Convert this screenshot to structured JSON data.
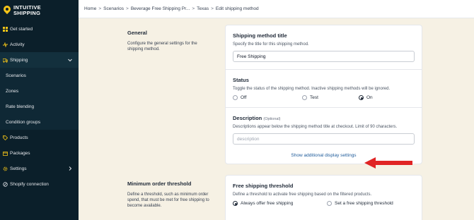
{
  "brand": {
    "line1": "INTUITIVE",
    "line2": "SHIPPING"
  },
  "sidebar": {
    "items": [
      {
        "label": "Get started",
        "icon": "grid-icon"
      },
      {
        "label": "Activity",
        "icon": "activity-icon"
      },
      {
        "label": "Shipping",
        "icon": "truck-icon"
      },
      {
        "label": "Scenarios"
      },
      {
        "label": "Zones"
      },
      {
        "label": "Rate blending"
      },
      {
        "label": "Condition groups"
      },
      {
        "label": "Products",
        "icon": "tag-icon"
      },
      {
        "label": "Packages",
        "icon": "box-icon"
      },
      {
        "label": "Settings",
        "icon": "gear-icon"
      },
      {
        "label": "Shopify connection",
        "icon": "link-icon"
      }
    ]
  },
  "breadcrumb": {
    "items": [
      "Home",
      "Scenarios",
      "Beverage Free Shipping Pr...",
      "Texas",
      "Edit shipping method"
    ],
    "separator": ">"
  },
  "general": {
    "title": "General",
    "description": "Configure the general settings for the shipping method."
  },
  "method_title": {
    "title": "Shipping method title",
    "hint": "Specify the title for this shipping method.",
    "value": "Free Shipping"
  },
  "status": {
    "title": "Status",
    "hint": "Toggle the status of the shipping method. Inactive shipping methods will be ignored.",
    "options": [
      "Off",
      "Test",
      "On"
    ],
    "selected": "On"
  },
  "description_field": {
    "title": "Description",
    "optional": "(Optional)",
    "hint": "Descriptions appear below the shipping method title at checkout. Limit of 90 characters.",
    "placeholder": "description"
  },
  "show_more": "Show additional display settings",
  "min_order": {
    "title": "Minimum order threshold",
    "description": "Define a threshold, such as minimum order spend, that must be met for free shipping to become available."
  },
  "free_threshold": {
    "title": "Free shipping threshold",
    "hint": "Define a threshold to activate free shipping based on the filtered products.",
    "options": [
      "Always offer free shipping",
      "Set a free shipping threshold"
    ],
    "selected": "Always offer free shipping"
  },
  "colors": {
    "sidebar": "#0b1f2a",
    "accent": "#f5c518",
    "arrow": "#e02424",
    "link": "#1e5b9a",
    "background": "#f6f1e4"
  }
}
